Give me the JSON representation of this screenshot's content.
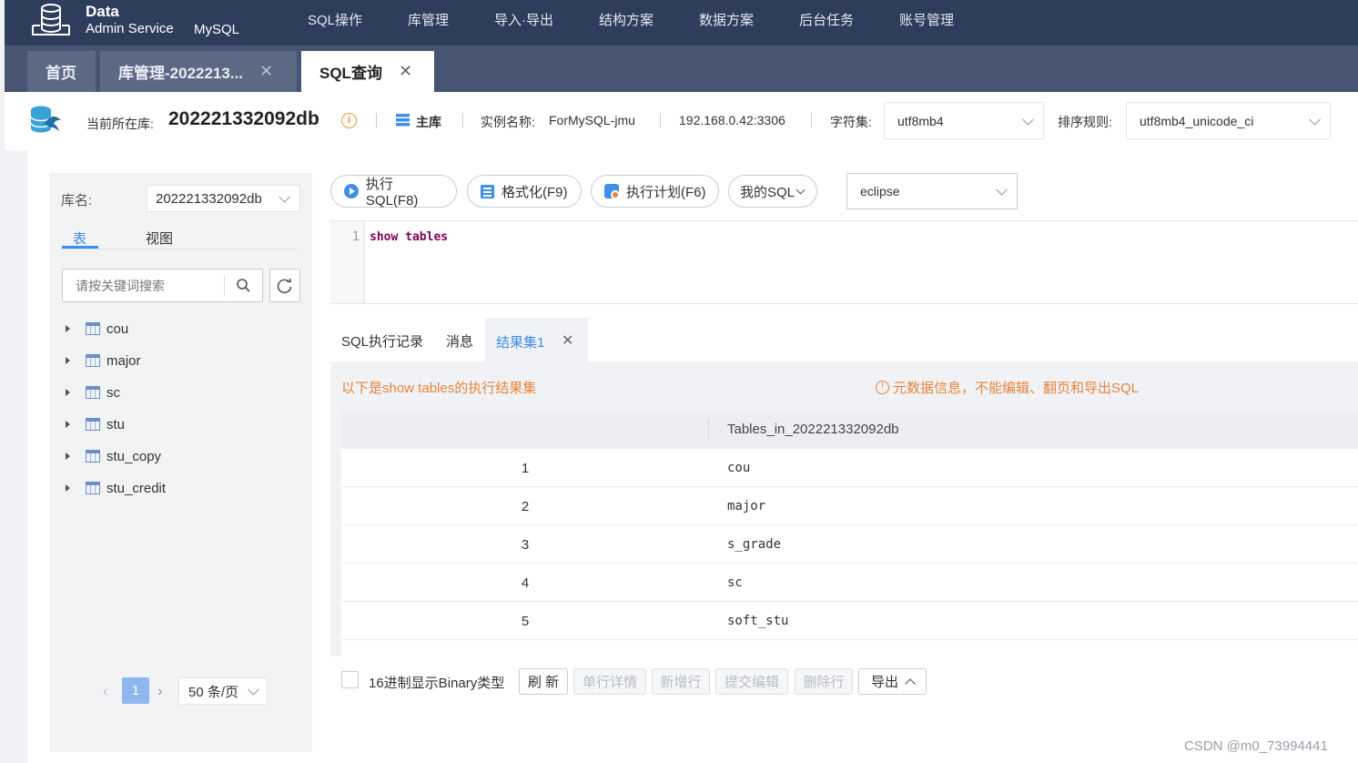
{
  "app": {
    "logo_line1": "Data",
    "logo_line2": "Admin Service",
    "logo_product": "MySQL"
  },
  "nav": [
    "SQL操作",
    "库管理",
    "导入·导出",
    "结构方案",
    "数据方案",
    "后台任务",
    "账号管理"
  ],
  "tabs": [
    {
      "label": "首页"
    },
    {
      "label": "库管理-2022213..."
    },
    {
      "label": "SQL查询"
    }
  ],
  "info": {
    "current_db_label": "当前所在库:",
    "current_db": "202221332092db",
    "role": "主库",
    "instance_label": "实例名称:",
    "instance": "ForMySQL-jmu",
    "address": "192.168.0.42:3306",
    "charset_label": "字符集:",
    "charset": "utf8mb4",
    "collation_label": "排序规则:",
    "collation": "utf8mb4_unicode_ci"
  },
  "left": {
    "db_label": "库名:",
    "db_value": "202221332092db",
    "tab_tables": "表",
    "tab_views": "视图",
    "search_placeholder": "请按关键词搜索",
    "tables": [
      "cou",
      "major",
      "sc",
      "stu",
      "stu_copy",
      "stu_credit"
    ],
    "page_current": "1",
    "page_size": "50 条/页"
  },
  "toolbar": {
    "run": "执行SQL(F8)",
    "format": "格式化(F9)",
    "plan": "执行计划(F6)",
    "my_sql": "我的SQL",
    "theme": "eclipse"
  },
  "editor": {
    "line_no": "1",
    "kw1": "show",
    "kw2": "tables"
  },
  "result_tabs": {
    "history": "SQL执行记录",
    "messages": "消息",
    "result1": "结果集1"
  },
  "result": {
    "caption": "以下是show tables的执行结果集",
    "warning": "元数据信息，不能编辑、翻页和导出SQL",
    "column": "Tables_in_202221332092db",
    "rows": [
      {
        "n": "1",
        "v": "cou"
      },
      {
        "n": "2",
        "v": "major"
      },
      {
        "n": "3",
        "v": "s_grade"
      },
      {
        "n": "4",
        "v": "sc"
      },
      {
        "n": "5",
        "v": "soft_stu"
      }
    ]
  },
  "status": {
    "hex_label": "16进制显示Binary类型",
    "refresh": "刷 新",
    "row_detail": "单行详情",
    "add_row": "新增行",
    "commit": "提交编辑",
    "delete_row": "删除行",
    "export": "导出"
  },
  "watermark": "CSDN @m0_73994441",
  "colors": {
    "nav_bg": "#2f3d5c",
    "accent": "#3f8ee8",
    "warning": "#e8843a"
  }
}
